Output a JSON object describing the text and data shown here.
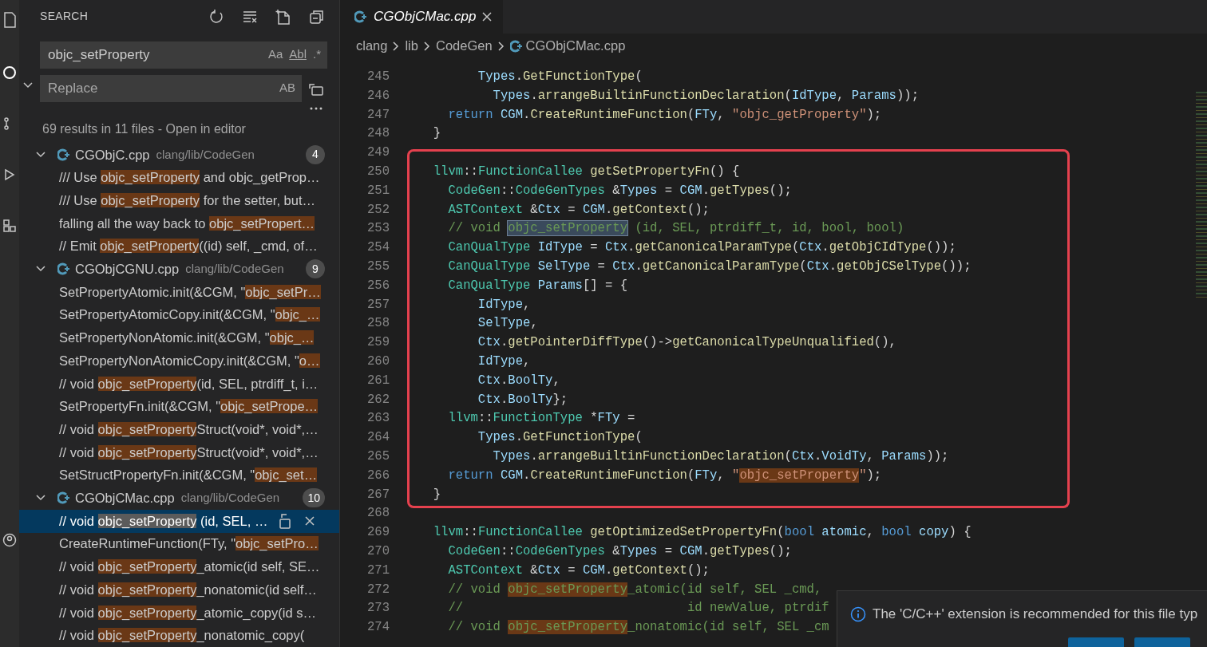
{
  "sidebar": {
    "title": "SEARCH",
    "replace_expanded": true,
    "search": {
      "value": "objc_setProperty",
      "options": [
        "Aa",
        "Abl",
        ".*"
      ]
    },
    "replace": {
      "placeholder": "Replace",
      "options": [
        "AB"
      ]
    },
    "summary": "69 results in 11 files - ",
    "summary_link": "Open in editor",
    "results": [
      {
        "file": "CGObjC.cpp",
        "path": "clang/lib/CodeGen",
        "count": "4",
        "expanded": true,
        "matches": [
          {
            "before": "/// Use ",
            "match": "objc_setProperty",
            "after": " and objc_getProp…",
            "selected": false
          },
          {
            "before": "/// Use ",
            "match": "objc_setProperty",
            "after": " for the setter, but…",
            "selected": false
          },
          {
            "before": "falling all the way back to ",
            "match": "objc_setPropert…",
            "selected": false
          },
          {
            "before": "// Emit ",
            "match": "objc_setProperty",
            "after": "((id) self, _cmd, of…",
            "selected": false
          }
        ]
      },
      {
        "file": "CGObjCGNU.cpp",
        "path": "clang/lib/CodeGen",
        "count": "9",
        "expanded": true,
        "matches": [
          {
            "before": "SetPropertyAtomic.init(&CGM, \"",
            "match": "objc_setPr…",
            "selected": false
          },
          {
            "before": "SetPropertyAtomicCopy.init(&CGM, \"",
            "match": "objc_…",
            "selected": false
          },
          {
            "before": "SetPropertyNonAtomic.init(&CGM, \"",
            "match": "objc_…",
            "selected": false
          },
          {
            "before": "SetPropertyNonAtomicCopy.init(&CGM, \"",
            "match": "o…",
            "selected": false
          },
          {
            "before": "// void ",
            "match": "objc_setProperty",
            "after": "(id, SEL, ptrdiff_t, i…",
            "selected": false
          },
          {
            "before": "SetPropertyFn.init(&CGM, \"",
            "match": "objc_setPrope…",
            "selected": false
          },
          {
            "before": "// void ",
            "match": "objc_setProperty",
            "after": "Struct(void*, void*,…",
            "selected": false
          },
          {
            "before": "// void ",
            "match": "objc_setProperty",
            "after": "Struct(void*, void*,…",
            "selected": false
          },
          {
            "before": "SetStructPropertyFn.init(&CGM, \"",
            "match": "objc_set…",
            "selected": false
          }
        ]
      },
      {
        "file": "CGObjCMac.cpp",
        "path": "clang/lib/CodeGen",
        "count": "10",
        "expanded": true,
        "matches": [
          {
            "before": "// void ",
            "match": "objc_setProperty",
            "after": " (id, SEL, …",
            "selected": true
          },
          {
            "before": "CreateRuntimeFunction(FTy, \"",
            "match": "objc_setPro…",
            "selected": false
          },
          {
            "before": "// void ",
            "match": "objc_setProperty",
            "after": "_atomic(id self, SE…",
            "selected": false
          },
          {
            "before": "// void ",
            "match": "objc_setProperty",
            "after": "_nonatomic(id self…",
            "selected": false
          },
          {
            "before": "// void ",
            "match": "objc_setProperty",
            "after": "_atomic_copy(id s…",
            "selected": false
          },
          {
            "before": "// void ",
            "match": "objc_setProperty",
            "after": "_nonatomic_copy(",
            "selected": false
          }
        ]
      }
    ]
  },
  "editor": {
    "tabs": [
      {
        "label": "CGObjCMac.cpp",
        "selected": true,
        "preview": true
      }
    ],
    "breadcrumb": [
      "clang",
      "lib",
      "CodeGen",
      "CGObjCMac.cpp"
    ],
    "lines": [
      {
        "number": "245",
        "boxed": false,
        "tokens": [
          {
            "kind": "var",
            "text": "        Types"
          },
          {
            "kind": "plain",
            "text": "."
          },
          {
            "kind": "fn",
            "text": "GetFunctionType"
          },
          {
            "kind": "plain",
            "text": "("
          }
        ]
      },
      {
        "number": "246",
        "boxed": false,
        "tokens": [
          {
            "kind": "var",
            "text": "          Types"
          },
          {
            "kind": "plain",
            "text": "."
          },
          {
            "kind": "fn",
            "text": "arrangeBuiltinFunctionDeclaration"
          },
          {
            "kind": "plain",
            "text": "("
          },
          {
            "kind": "var",
            "text": "IdType"
          },
          {
            "kind": "plain",
            "text": ", "
          },
          {
            "kind": "var",
            "text": "Params"
          },
          {
            "kind": "plain",
            "text": "));"
          }
        ]
      },
      {
        "number": "247",
        "boxed": false,
        "tokens": [
          {
            "kind": "kw",
            "text": "    return"
          },
          {
            "kind": "var",
            "text": " CGM"
          },
          {
            "kind": "plain",
            "text": "."
          },
          {
            "kind": "fn",
            "text": "CreateRuntimeFunction"
          },
          {
            "kind": "plain",
            "text": "("
          },
          {
            "kind": "var",
            "text": "FTy"
          },
          {
            "kind": "plain",
            "text": ", "
          },
          {
            "kind": "str",
            "text": "\"objc_getProperty\""
          },
          {
            "kind": "plain",
            "text": ");"
          }
        ]
      },
      {
        "number": "248",
        "boxed": false,
        "tokens": [
          {
            "kind": "plain",
            "text": "  }"
          }
        ]
      },
      {
        "number": "249",
        "boxed": false
      },
      {
        "number": "250",
        "boxed": true,
        "tokens": [
          {
            "kind": "type",
            "text": "  llvm"
          },
          {
            "kind": "plain",
            "text": "::"
          },
          {
            "kind": "type",
            "text": "FunctionCallee"
          },
          {
            "kind": "fn",
            "text": " getSetPropertyFn"
          },
          {
            "kind": "plain",
            "text": "() {"
          }
        ]
      },
      {
        "number": "251",
        "boxed": true,
        "tokens": [
          {
            "kind": "type",
            "text": "    CodeGen"
          },
          {
            "kind": "plain",
            "text": "::"
          },
          {
            "kind": "type",
            "text": "CodeGenTypes"
          },
          {
            "kind": "plain",
            "text": " &"
          },
          {
            "kind": "var",
            "text": "Types"
          },
          {
            "kind": "plain",
            "text": " = "
          },
          {
            "kind": "var",
            "text": "CGM"
          },
          {
            "kind": "plain",
            "text": "."
          },
          {
            "kind": "fn",
            "text": "getTypes"
          },
          {
            "kind": "plain",
            "text": "();"
          }
        ]
      },
      {
        "number": "252",
        "boxed": true,
        "tokens": [
          {
            "kind": "type",
            "text": "    ASTContext"
          },
          {
            "kind": "plain",
            "text": " &"
          },
          {
            "kind": "var",
            "text": "Ctx"
          },
          {
            "kind": "plain",
            "text": " = "
          },
          {
            "kind": "var",
            "text": "CGM"
          },
          {
            "kind": "plain",
            "text": "."
          },
          {
            "kind": "fn",
            "text": "getContext"
          },
          {
            "kind": "plain",
            "text": "();"
          }
        ]
      },
      {
        "number": "253",
        "boxed": true,
        "tokens": [
          {
            "kind": "cm",
            "text": "    // void "
          },
          {
            "kind": "cm",
            "text": "objc_setProperty",
            "matched": true,
            "current": true
          },
          {
            "kind": "cm",
            "text": " (id, SEL, ptrdiff_t, id, bool, bool)"
          }
        ]
      },
      {
        "number": "254",
        "boxed": true,
        "tokens": [
          {
            "kind": "type",
            "text": "    CanQualType"
          },
          {
            "kind": "var",
            "text": " IdType"
          },
          {
            "kind": "plain",
            "text": " = "
          },
          {
            "kind": "var",
            "text": "Ctx"
          },
          {
            "kind": "plain",
            "text": "."
          },
          {
            "kind": "fn",
            "text": "getCanonicalParamType"
          },
          {
            "kind": "plain",
            "text": "("
          },
          {
            "kind": "var",
            "text": "Ctx"
          },
          {
            "kind": "plain",
            "text": "."
          },
          {
            "kind": "fn",
            "text": "getObjCIdType"
          },
          {
            "kind": "plain",
            "text": "());"
          }
        ]
      },
      {
        "number": "255",
        "boxed": true,
        "tokens": [
          {
            "kind": "type",
            "text": "    CanQualType"
          },
          {
            "kind": "var",
            "text": " SelType"
          },
          {
            "kind": "plain",
            "text": " = "
          },
          {
            "kind": "var",
            "text": "Ctx"
          },
          {
            "kind": "plain",
            "text": "."
          },
          {
            "kind": "fn",
            "text": "getCanonicalParamType"
          },
          {
            "kind": "plain",
            "text": "("
          },
          {
            "kind": "var",
            "text": "Ctx"
          },
          {
            "kind": "plain",
            "text": "."
          },
          {
            "kind": "fn",
            "text": "getObjCSelType"
          },
          {
            "kind": "plain",
            "text": "());"
          }
        ]
      },
      {
        "number": "256",
        "boxed": true,
        "tokens": [
          {
            "kind": "type",
            "text": "    CanQualType"
          },
          {
            "kind": "var",
            "text": " Params"
          },
          {
            "kind": "plain",
            "text": "[] = {"
          }
        ]
      },
      {
        "number": "257",
        "boxed": true,
        "tokens": [
          {
            "kind": "var",
            "text": "        IdType"
          },
          {
            "kind": "plain",
            "text": ","
          }
        ]
      },
      {
        "number": "258",
        "boxed": true,
        "tokens": [
          {
            "kind": "var",
            "text": "        SelType"
          },
          {
            "kind": "plain",
            "text": ","
          }
        ]
      },
      {
        "number": "259",
        "boxed": true,
        "tokens": [
          {
            "kind": "var",
            "text": "        Ctx"
          },
          {
            "kind": "plain",
            "text": "."
          },
          {
            "kind": "fn",
            "text": "getPointerDiffType"
          },
          {
            "kind": "plain",
            "text": "()->"
          },
          {
            "kind": "fn",
            "text": "getCanonicalTypeUnqualified"
          },
          {
            "kind": "plain",
            "text": "(),"
          }
        ]
      },
      {
        "number": "260",
        "boxed": true,
        "tokens": [
          {
            "kind": "var",
            "text": "        IdType"
          },
          {
            "kind": "plain",
            "text": ","
          }
        ]
      },
      {
        "number": "261",
        "boxed": true,
        "tokens": [
          {
            "kind": "var",
            "text": "        Ctx"
          },
          {
            "kind": "plain",
            "text": "."
          },
          {
            "kind": "var",
            "text": "BoolTy"
          },
          {
            "kind": "plain",
            "text": ","
          }
        ]
      },
      {
        "number": "262",
        "boxed": true,
        "tokens": [
          {
            "kind": "var",
            "text": "        Ctx"
          },
          {
            "kind": "plain",
            "text": "."
          },
          {
            "kind": "var",
            "text": "BoolTy"
          },
          {
            "kind": "plain",
            "text": "};"
          }
        ]
      },
      {
        "number": "263",
        "boxed": true,
        "tokens": [
          {
            "kind": "type",
            "text": "    llvm"
          },
          {
            "kind": "plain",
            "text": "::"
          },
          {
            "kind": "type",
            "text": "FunctionType"
          },
          {
            "kind": "plain",
            "text": " *"
          },
          {
            "kind": "var",
            "text": "FTy"
          },
          {
            "kind": "plain",
            "text": " ="
          }
        ]
      },
      {
        "number": "264",
        "boxed": true,
        "tokens": [
          {
            "kind": "var",
            "text": "        Types"
          },
          {
            "kind": "plain",
            "text": "."
          },
          {
            "kind": "fn",
            "text": "GetFunctionType"
          },
          {
            "kind": "plain",
            "text": "("
          }
        ]
      },
      {
        "number": "265",
        "boxed": true,
        "tokens": [
          {
            "kind": "var",
            "text": "          Types"
          },
          {
            "kind": "plain",
            "text": "."
          },
          {
            "kind": "fn",
            "text": "arrangeBuiltinFunctionDeclaration"
          },
          {
            "kind": "plain",
            "text": "("
          },
          {
            "kind": "var",
            "text": "Ctx"
          },
          {
            "kind": "plain",
            "text": "."
          },
          {
            "kind": "var",
            "text": "VoidTy"
          },
          {
            "kind": "plain",
            "text": ", "
          },
          {
            "kind": "var",
            "text": "Params"
          },
          {
            "kind": "plain",
            "text": "));"
          }
        ]
      },
      {
        "number": "266",
        "boxed": true,
        "tokens": [
          {
            "kind": "kw",
            "text": "    return"
          },
          {
            "kind": "var",
            "text": " CGM"
          },
          {
            "kind": "plain",
            "text": "."
          },
          {
            "kind": "fn",
            "text": "CreateRuntimeFunction"
          },
          {
            "kind": "plain",
            "text": "("
          },
          {
            "kind": "var",
            "text": "FTy"
          },
          {
            "kind": "plain",
            "text": ", "
          },
          {
            "kind": "str",
            "text": "\""
          },
          {
            "kind": "str",
            "text": "objc_setProperty",
            "matched": true,
            "current": false
          },
          {
            "kind": "str",
            "text": "\""
          },
          {
            "kind": "plain",
            "text": ");"
          }
        ]
      },
      {
        "number": "267",
        "boxed": true,
        "tokens": [
          {
            "kind": "plain",
            "text": "  }"
          }
        ]
      },
      {
        "number": "268",
        "boxed": false
      },
      {
        "number": "269",
        "boxed": false,
        "tokens": [
          {
            "kind": "type",
            "text": "  llvm"
          },
          {
            "kind": "plain",
            "text": "::"
          },
          {
            "kind": "type",
            "text": "FunctionCallee"
          },
          {
            "kind": "fn",
            "text": " getOptimizedSetPropertyFn"
          },
          {
            "kind": "plain",
            "text": "("
          },
          {
            "kind": "kw",
            "text": "bool"
          },
          {
            "kind": "var",
            "text": " atomic"
          },
          {
            "kind": "plain",
            "text": ", "
          },
          {
            "kind": "kw",
            "text": "bool"
          },
          {
            "kind": "var",
            "text": " copy"
          },
          {
            "kind": "plain",
            "text": ") {"
          }
        ]
      },
      {
        "number": "270",
        "boxed": false,
        "tokens": [
          {
            "kind": "type",
            "text": "    CodeGen"
          },
          {
            "kind": "plain",
            "text": "::"
          },
          {
            "kind": "type",
            "text": "CodeGenTypes"
          },
          {
            "kind": "plain",
            "text": " &"
          },
          {
            "kind": "var",
            "text": "Types"
          },
          {
            "kind": "plain",
            "text": " = "
          },
          {
            "kind": "var",
            "text": "CGM"
          },
          {
            "kind": "plain",
            "text": "."
          },
          {
            "kind": "fn",
            "text": "getTypes"
          },
          {
            "kind": "plain",
            "text": "();"
          }
        ]
      },
      {
        "number": "271",
        "boxed": false,
        "tokens": [
          {
            "kind": "type",
            "text": "    ASTContext"
          },
          {
            "kind": "plain",
            "text": " &"
          },
          {
            "kind": "var",
            "text": "Ctx"
          },
          {
            "kind": "plain",
            "text": " = "
          },
          {
            "kind": "var",
            "text": "CGM"
          },
          {
            "kind": "plain",
            "text": "."
          },
          {
            "kind": "fn",
            "text": "getContext"
          },
          {
            "kind": "plain",
            "text": "();"
          }
        ]
      },
      {
        "number": "272",
        "boxed": false,
        "tokens": [
          {
            "kind": "cm",
            "text": "    // void "
          },
          {
            "kind": "cm",
            "text": "objc_setProperty",
            "matched": true,
            "current": false
          },
          {
            "kind": "cm",
            "text": "_atomic(id self, SEL _cmd,"
          }
        ]
      },
      {
        "number": "273",
        "boxed": false,
        "tokens": [
          {
            "kind": "cm",
            "text": "    //                              id newValue, ptrdif"
          }
        ]
      },
      {
        "number": "274",
        "boxed": false,
        "tokens": [
          {
            "kind": "cm",
            "text": "    // void "
          },
          {
            "kind": "cm",
            "text": "objc_setProperty",
            "matched": true,
            "current": false
          },
          {
            "kind": "cm",
            "text": "_nonatomic(id self, SEL _cm"
          }
        ]
      }
    ]
  },
  "notification": {
    "message": "The 'C/C++' extension is recommended for this file typ"
  }
}
